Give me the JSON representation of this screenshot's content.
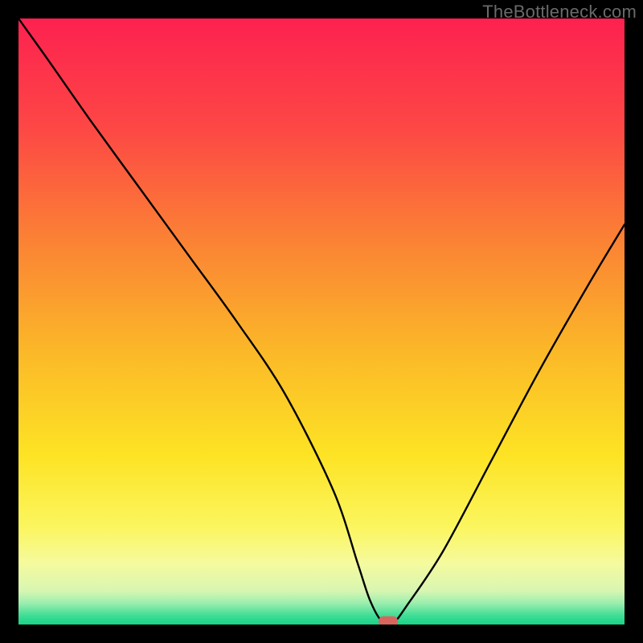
{
  "watermark": "TheBottleneck.com",
  "chart_data": {
    "type": "line",
    "title": "",
    "xlabel": "",
    "ylabel": "",
    "xlim": [
      0,
      100
    ],
    "ylim": [
      0,
      100
    ],
    "series": [
      {
        "name": "bottleneck-curve",
        "x": [
          0,
          5,
          12,
          20,
          28,
          36,
          44,
          52,
          56,
          58,
          60,
          62,
          64,
          70,
          78,
          86,
          94,
          100
        ],
        "y": [
          100,
          93,
          83,
          72,
          61,
          50,
          38,
          22,
          10,
          4,
          0.5,
          0.5,
          3,
          12,
          27,
          42,
          56,
          66
        ]
      }
    ],
    "marker": {
      "name": "optimal-point",
      "x": 61,
      "y": 0.5,
      "color": "#d9655f"
    },
    "background_gradient": {
      "stops": [
        {
          "offset": 0.0,
          "color": "#fd2150"
        },
        {
          "offset": 0.18,
          "color": "#fd4745"
        },
        {
          "offset": 0.36,
          "color": "#fb8035"
        },
        {
          "offset": 0.55,
          "color": "#fbb828"
        },
        {
          "offset": 0.72,
          "color": "#fde324"
        },
        {
          "offset": 0.84,
          "color": "#fbf65f"
        },
        {
          "offset": 0.9,
          "color": "#f5fa9e"
        },
        {
          "offset": 0.945,
          "color": "#d7f6b2"
        },
        {
          "offset": 0.965,
          "color": "#9aeeae"
        },
        {
          "offset": 0.985,
          "color": "#40dd96"
        },
        {
          "offset": 1.0,
          "color": "#18d487"
        }
      ]
    }
  }
}
